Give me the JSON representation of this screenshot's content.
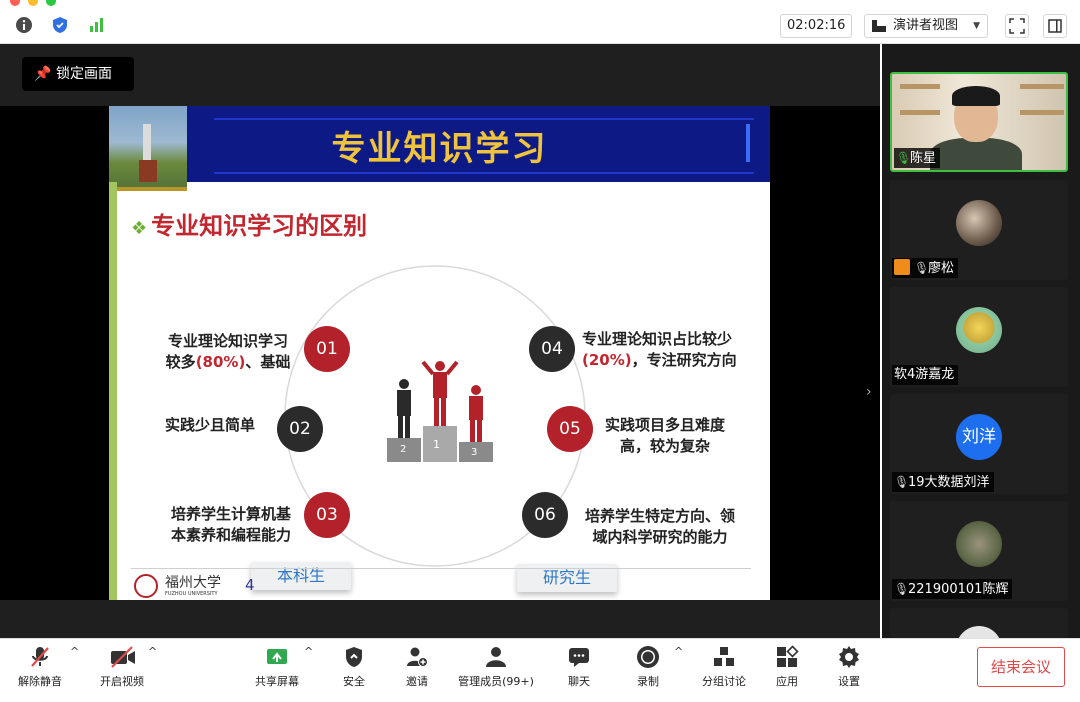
{
  "header": {
    "timer": "02:02:16",
    "view_mode": "演讲者视图",
    "icons": [
      "info-icon",
      "shield-icon",
      "signal-icon",
      "fullscreen-icon",
      "panel-toggle-icon"
    ]
  },
  "stage": {
    "lock_label": "锁定画面"
  },
  "slide": {
    "title": "专业知识学习",
    "subtitle": "专业知识学习的区别",
    "points": [
      {
        "num": "01",
        "text_a": "专业理论知识学习",
        "text_b": "较多",
        "highlight": "(80%)",
        "text_c": "、基础"
      },
      {
        "num": "02",
        "text": "实践少且简单"
      },
      {
        "num": "03",
        "line1": "培养学生计算机基",
        "line2": "本素养和编程能力"
      },
      {
        "num": "04",
        "line1": "专业理论知识占比较少",
        "highlight": "(20%)",
        "line2_rest": "，专注研究方向"
      },
      {
        "num": "05",
        "line1": "实践项目多且难度",
        "line2": "高，较为复杂"
      },
      {
        "num": "06",
        "line1": "培养学生特定方向、领",
        "line2": "域内科学研究的能力"
      }
    ],
    "podium": [
      "1",
      "2",
      "3"
    ],
    "label_left": "本科生",
    "label_right": "研究生",
    "logo_text": "福州大学",
    "logo_sub": "FUZHOU UNIVERSITY",
    "page_number": "4"
  },
  "participants": [
    {
      "name": "陈星",
      "mic": "on"
    },
    {
      "name": "廖松",
      "mic": "muted"
    },
    {
      "name": "软4游嘉龙",
      "mic": "none"
    },
    {
      "name": "19大数据刘洋",
      "mic": "muted",
      "avatar_text": "刘洋"
    },
    {
      "name": "221900101陈辉",
      "mic": "muted"
    }
  ],
  "toolbar": {
    "unmute": "解除静音",
    "start_video": "开启视频",
    "share_screen": "共享屏幕",
    "security": "安全",
    "invite": "邀请",
    "participants": "管理成员(99+)",
    "chat": "聊天",
    "record": "录制",
    "breakout": "分组讨论",
    "apps": "应用",
    "settings": "设置",
    "end_meeting": "结束会议"
  },
  "colors": {
    "accent_green": "#3fbf3f",
    "end_red": "#e04a4a",
    "slide_blue": "#0d1a86",
    "slide_gold": "#f0c33c",
    "slide_red": "#c2262e"
  }
}
